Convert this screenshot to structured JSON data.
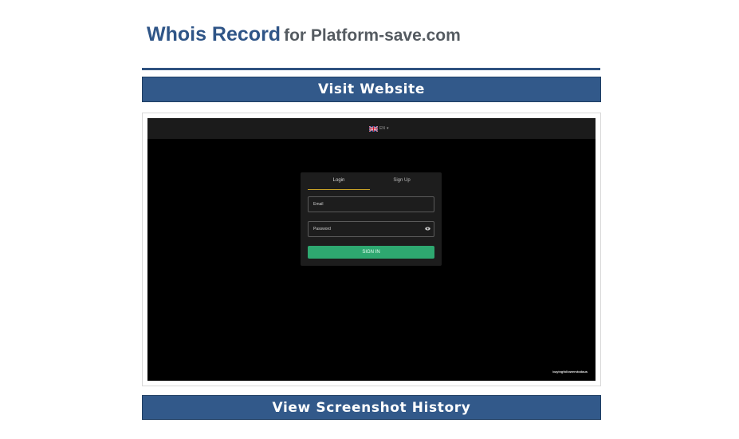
{
  "heading": {
    "main": "Whois Record",
    "sub": "for Platform-save.com"
  },
  "buttons": {
    "visit": "Visit Website",
    "history": "View Screenshot History"
  },
  "screenshot": {
    "language_code": "EN",
    "tabs": {
      "login": "Login",
      "signup": "Sign Up"
    },
    "fields": {
      "email_placeholder": "Email",
      "password_placeholder": "Password"
    },
    "submit": "SIGN IN",
    "watermark": "buyingfollowerstodaus"
  },
  "icons": {
    "flag": "uk-flag-icon",
    "chevron": "chevron-down-icon",
    "eye": "eye-icon"
  },
  "colors": {
    "brand_blue": "#32598a",
    "heading_blue": "#2f5587",
    "signin_green": "#2ea870",
    "tab_underline": "#c9a227"
  }
}
